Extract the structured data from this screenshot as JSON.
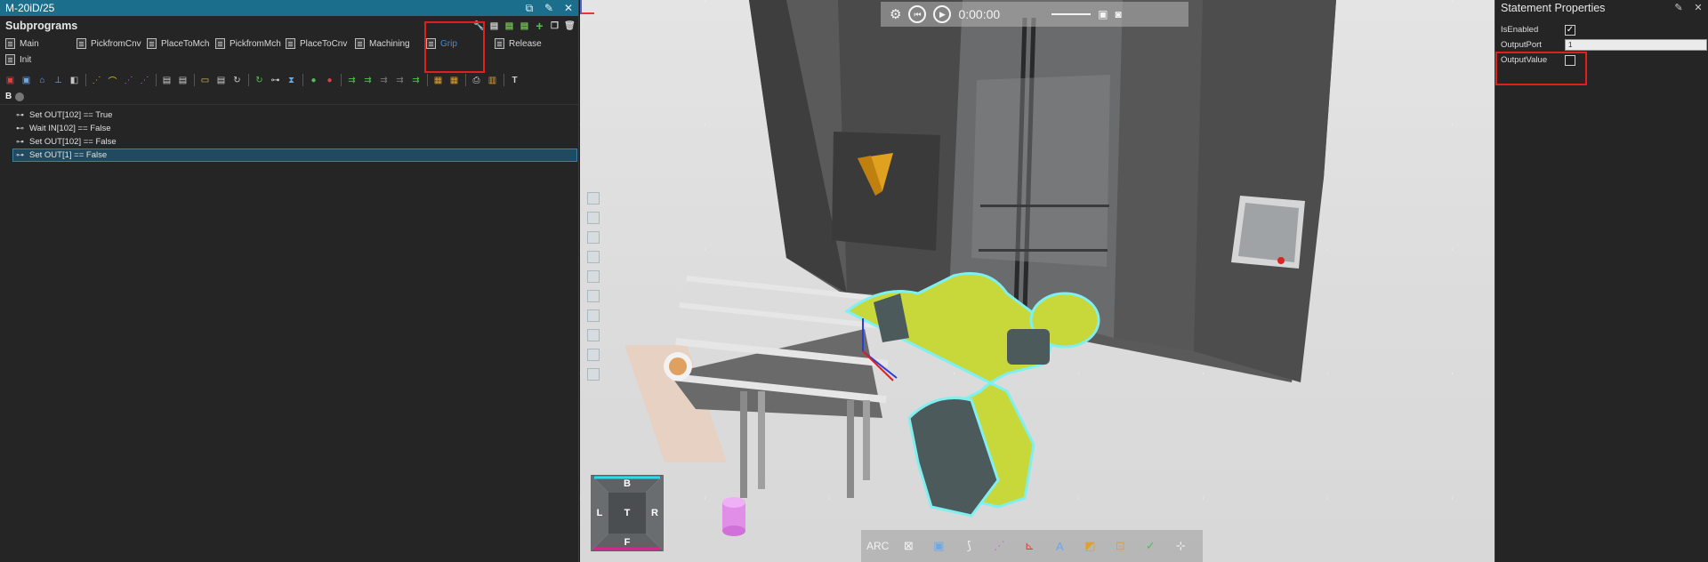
{
  "left_panel": {
    "title": "M-20iD/25",
    "section_title": "Subprograms",
    "tabs": [
      {
        "label": "Main"
      },
      {
        "label": "PickfromCnv"
      },
      {
        "label": "PlaceToMch"
      },
      {
        "label": "PickfromMch"
      },
      {
        "label": "PlaceToCnv"
      },
      {
        "label": "Machining"
      },
      {
        "label": "Grip",
        "active": true
      },
      {
        "label": "Release"
      },
      {
        "label": "Init"
      }
    ],
    "statements": [
      {
        "text": "Set OUT[102] == True"
      },
      {
        "text": "Wait IN[102] == False"
      },
      {
        "text": "Set OUT[102] == False"
      },
      {
        "text": "Set OUT[1] == False",
        "selected": true
      }
    ],
    "sub_toolbar_label": "B"
  },
  "viewport": {
    "playback_time": "0:00:00",
    "navcube": {
      "top": "B",
      "left": "L",
      "center": "T",
      "right": "R",
      "bottom": "F"
    },
    "bottom_toolbar": {
      "arc_label": "ARC"
    }
  },
  "right_panel": {
    "title": "Statement Properties",
    "properties": [
      {
        "name": "IsEnabled",
        "checked": true
      },
      {
        "name": "OutputPort",
        "value": "1"
      },
      {
        "name": "OutputValue",
        "checked": false
      }
    ]
  },
  "colors": {
    "title_bar": "#1c6f8c",
    "highlight_red": "#e0201b",
    "robot_yellow": "#c8d73a",
    "selection_blue": "#1f4a60"
  }
}
